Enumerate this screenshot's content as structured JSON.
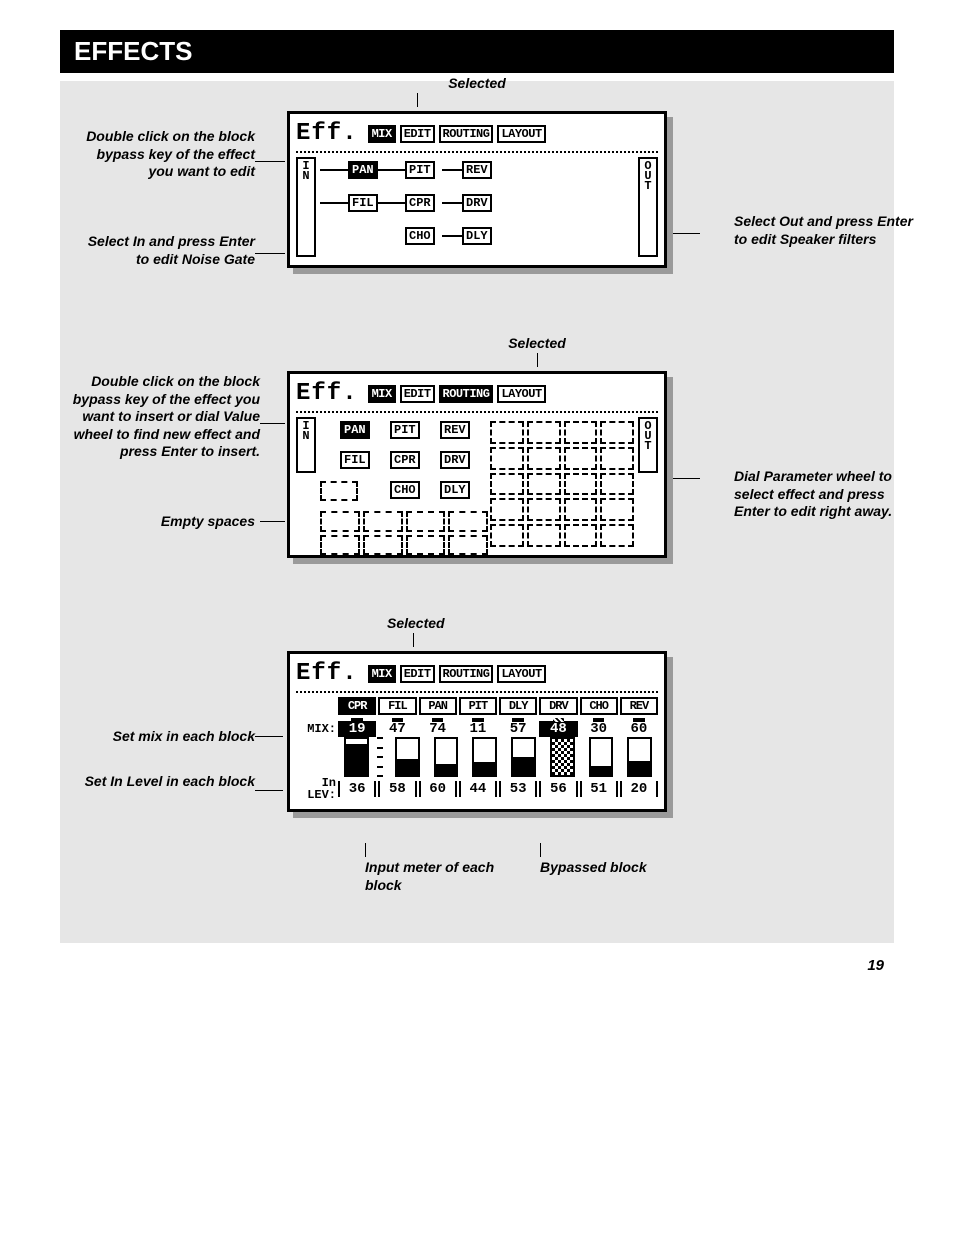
{
  "title": "EFFECTS",
  "page_number": "19",
  "screens": {
    "s1": {
      "selected_label": "Selected",
      "eff": "Eff.",
      "tabs": [
        {
          "label": "MIX",
          "sel": true
        },
        {
          "label": "EDIT",
          "sel": false
        },
        {
          "label": "ROUTING",
          "sel": false
        },
        {
          "label": "LAYOUT",
          "sel": false
        }
      ],
      "in": [
        "I",
        "N"
      ],
      "out": [
        "O",
        "U",
        "T"
      ],
      "rows": [
        [
          {
            "l": "PAN",
            "sel": true
          },
          {
            "l": "PIT"
          },
          {
            "l": "REV"
          }
        ],
        [
          {
            "l": "FIL"
          },
          {
            "l": "CPR"
          },
          {
            "l": "DRV"
          }
        ],
        [
          null,
          {
            "l": "CHO"
          },
          {
            "l": "DLY"
          }
        ]
      ],
      "notes": {
        "left1": "Double click on the block bypass key of the effect you want to edit",
        "left2": "Select In and press Enter to edit Noise Gate",
        "right1": "Select Out and press Enter to edit Speaker filters"
      }
    },
    "s2": {
      "selected_label": "Selected",
      "eff": "Eff.",
      "tabs": [
        {
          "label": "MIX",
          "sel": true
        },
        {
          "label": "EDIT",
          "sel": false
        },
        {
          "label": "ROUTING",
          "sel": true
        },
        {
          "label": "LAYOUT",
          "sel": false
        }
      ],
      "in": [
        "I",
        "N"
      ],
      "out": [
        "O",
        "U",
        "T"
      ],
      "blocks": [
        "PAN",
        "PIT",
        "REV",
        "FIL",
        "CPR",
        "DRV",
        "CHO",
        "DLY"
      ],
      "notes": {
        "left1": "Double click on the block bypass key of the effect you want to insert or dial Value wheel to find new effect and press Enter to insert.",
        "left2": "Empty spaces",
        "right1": "Dial Parameter wheel to select effect and press Enter to edit right away."
      }
    },
    "s3": {
      "selected_label": "Selected",
      "eff": "Eff.",
      "tabs": [
        {
          "label": "MIX",
          "sel": true
        },
        {
          "label": "EDIT",
          "sel": false
        },
        {
          "label": "ROUTING",
          "sel": false
        },
        {
          "label": "LAYOUT",
          "sel": false
        }
      ],
      "head": [
        "CPR",
        "FIL",
        "PAN",
        "PIT",
        "DLY",
        "DRV",
        "CHO",
        "REV"
      ],
      "head_sel": [
        0,
        5
      ],
      "bypassed_idx": 5,
      "mix_label": "MIX:",
      "mix": [
        "19",
        "47",
        "74",
        "11",
        "57",
        "48",
        "30",
        "60"
      ],
      "mix_sel": [
        0,
        5
      ],
      "in_label1": "In",
      "in_label2": "LEV:",
      "lev": [
        "36",
        "58",
        "60",
        "44",
        "53",
        "56",
        "51",
        "20"
      ],
      "meter_fill_pct": [
        85,
        45,
        30,
        35,
        50,
        0,
        25,
        40
      ],
      "notes": {
        "left1": "Set mix in each block",
        "left2": "Set In Level in each block",
        "bottom1": "Input meter of each block",
        "bottom2": "Bypassed block"
      }
    }
  }
}
